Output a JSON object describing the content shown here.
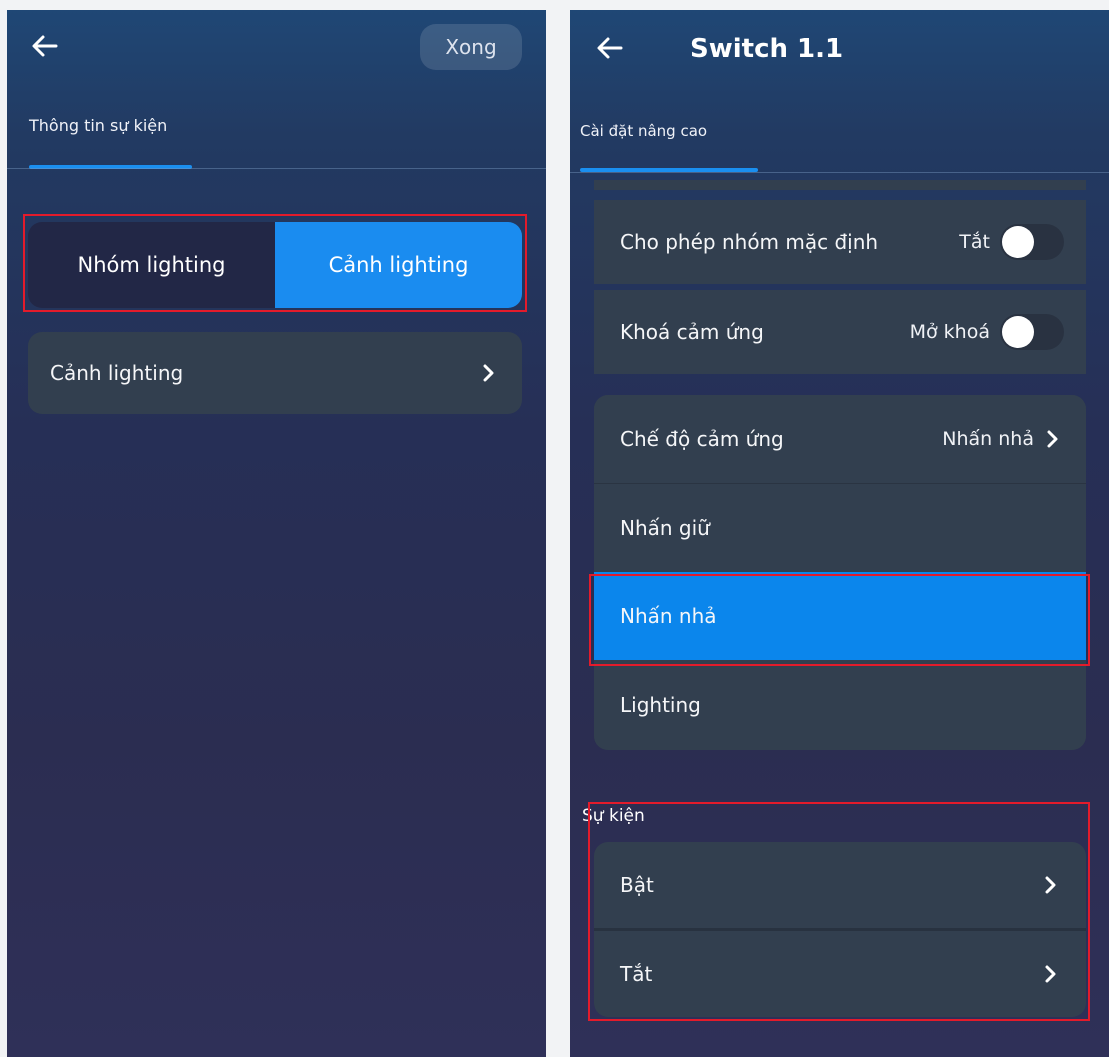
{
  "left": {
    "done_label": "Xong",
    "tab_label": "Thông tin sự kiện",
    "segment": {
      "options": [
        "Nhóm lighting",
        "Cảnh lighting"
      ],
      "selected": "Cảnh lighting"
    },
    "row_label": "Cảnh lighting"
  },
  "right": {
    "title": "Switch 1.1",
    "tab_label": "Cài đặt nâng cao",
    "settings": [
      {
        "label": "Cho phép nhóm mặc định",
        "value": "Tắt",
        "toggle": "off"
      },
      {
        "label": "Khoá cảm ứng",
        "value": "Mở khoá",
        "toggle": "off"
      }
    ],
    "touch_mode": {
      "label": "Chế độ cảm ứng",
      "value": "Nhấn nhả",
      "options": [
        "Nhấn giữ",
        "Nhấn nhả",
        "Lighting"
      ],
      "selected": "Nhấn nhả"
    },
    "events": {
      "section_label": "Sự kiện",
      "items": [
        "Bật",
        "Tắt"
      ]
    }
  },
  "colors": {
    "accent": "#1a8cf0",
    "highlight_border": "#e31b2b",
    "card": "#323f4f",
    "segment_dark": "#222746"
  },
  "icons": [
    "back-arrow-icon",
    "chevron-right-icon"
  ]
}
